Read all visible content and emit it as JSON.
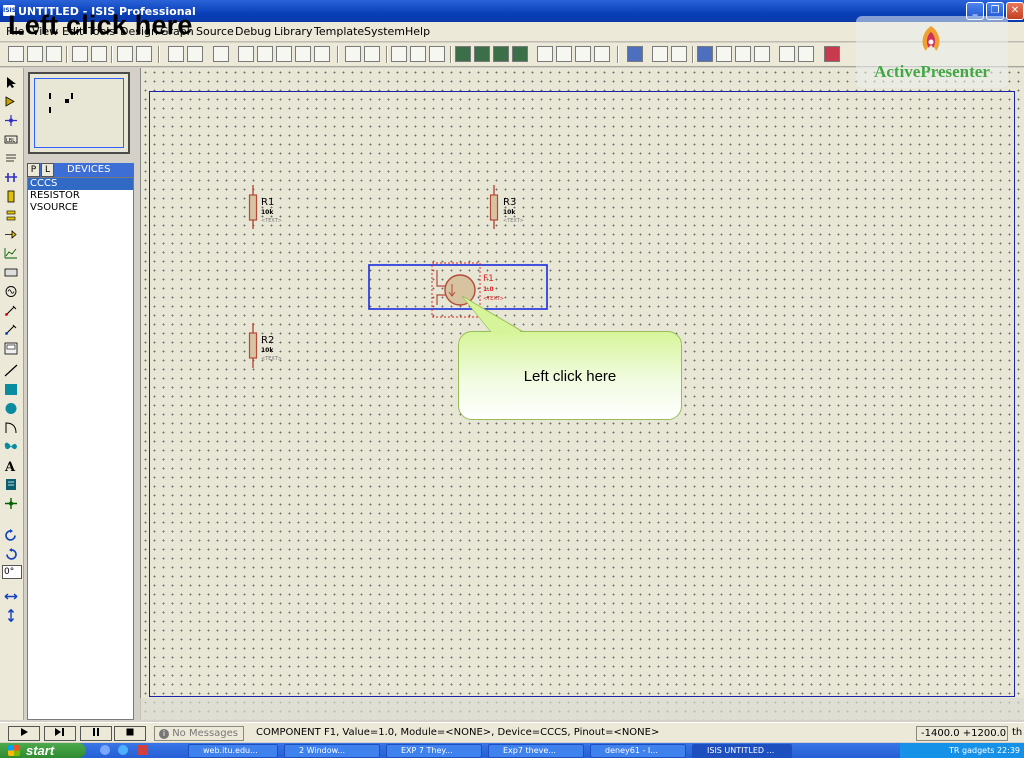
{
  "window": {
    "app_icon": "ISIS",
    "title": "UNTITLED - ISIS Professional",
    "minimize_icon": "minimize-icon",
    "maximize_icon": "maximize-icon",
    "close_icon": "close-icon"
  },
  "caption": "Left click here",
  "menu": {
    "items": [
      "File",
      "View",
      "Edit",
      "Tools",
      "Design",
      "Graph",
      "Source",
      "Debug",
      "Library",
      "Template",
      "System",
      "Help"
    ]
  },
  "overview": {
    "label": "overview-window"
  },
  "devices": {
    "p_label": "P",
    "l_label": "L",
    "title": "DEVICES",
    "items": [
      {
        "name": "CCCS",
        "selected": true
      },
      {
        "name": "RESISTOR",
        "selected": false
      },
      {
        "name": "VSOURCE",
        "selected": false
      }
    ]
  },
  "schematic": {
    "resistors": [
      {
        "ref": "R1",
        "value": "10k",
        "text": "<TEXT>"
      },
      {
        "ref": "R3",
        "value": "10k",
        "text": "<TEXT>"
      },
      {
        "ref": "R2",
        "value": "10k",
        "text": "<TEXT>"
      }
    ],
    "source": {
      "ref": "F1",
      "value": "1.0",
      "text": "<TEXT>"
    }
  },
  "callout": {
    "text": "Left click here"
  },
  "rotation": {
    "value": "0°"
  },
  "watermark": {
    "text": "ActivePresenter"
  },
  "status": {
    "message": "No Messages",
    "component_info": "COMPONENT F1, Value=1.0, Module=<NONE>, Device=CCCS, Pinout=<NONE>",
    "coords": "-1400.0   +1200.0",
    "unit": "th"
  },
  "taskbar": {
    "start_label": "start",
    "tasks": [
      "web.itu.edu...",
      "2 Window...",
      "EXP 7 They...",
      "Exp7 theve...",
      "deney61 - I...",
      "ISIS UNTITLED ..."
    ],
    "tray_text": "TR    gadgets     22:39"
  },
  "colors": {
    "canvas": "#e8e6d5",
    "sheet_border": "#1a23a8",
    "selection": "#1a2ee0",
    "component": "#b44a3a",
    "tag_red": "#e02020",
    "callout_green": "#d6f59a",
    "watermark_green": "#43a844"
  }
}
